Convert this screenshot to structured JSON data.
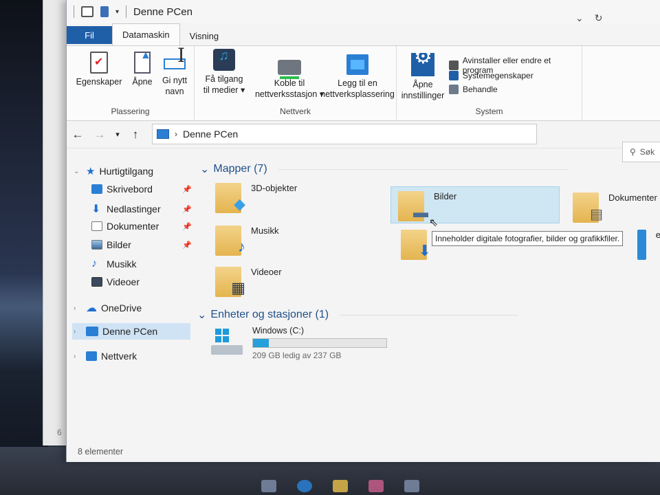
{
  "window": {
    "title": "Denne PCen",
    "status": "8 elementer"
  },
  "back_window": {
    "mini_text": "6"
  },
  "tabs": [
    {
      "label": "Fil"
    },
    {
      "label": "Datamaskin"
    },
    {
      "label": "Visning"
    }
  ],
  "ribbon": {
    "plassering": {
      "label": "Plassering",
      "buttons": [
        {
          "label": "Egenskaper",
          "icon": "properties-icon"
        },
        {
          "label": "Åpne",
          "icon": "open-icon"
        },
        {
          "label": "Gi nytt",
          "label2": "navn",
          "icon": "rename-icon"
        }
      ]
    },
    "nettverk": {
      "label": "Nettverk",
      "buttons": [
        {
          "label": "Få tilgang",
          "label2": "til medier ▾",
          "icon": "media-icon"
        },
        {
          "label": "Koble til",
          "label2": "nettverksstasjon ▾",
          "icon": "network-drive-icon"
        },
        {
          "label": "Legg til en",
          "label2": "nettverksplassering",
          "icon": "network-location-icon"
        }
      ]
    },
    "system": {
      "label": "System",
      "settings_label": "Åpne",
      "settings_label2": "innstillinger",
      "items": [
        {
          "label": "Avinstaller eller endre et program"
        },
        {
          "label": "Systemegenskaper"
        },
        {
          "label": "Behandle"
        }
      ]
    }
  },
  "address": {
    "path": "Denne PCen",
    "search_placeholder": "Søk"
  },
  "sidebar": {
    "quick_access": "Hurtigtilgang",
    "items": [
      {
        "label": "Skrivebord"
      },
      {
        "label": "Nedlastinger"
      },
      {
        "label": "Dokumenter"
      },
      {
        "label": "Bilder"
      },
      {
        "label": "Musikk"
      },
      {
        "label": "Videoer"
      }
    ],
    "onedrive": "OneDrive",
    "this_pc": "Denne PCen",
    "network": "Nettverk"
  },
  "content": {
    "folders_header": "Mapper (7)",
    "folders": [
      {
        "label": "3D-objekter"
      },
      {
        "label": "Bilder"
      },
      {
        "label": "Dokumenter"
      },
      {
        "label": "Musikk"
      },
      {
        "label": "ebord"
      },
      {
        "label": "Videoer"
      }
    ],
    "tooltip": "Inneholder digitale fotografier, bilder og grafikkfiler.",
    "devices_header": "Enheter og stasjoner (1)",
    "drive": {
      "name": "Windows (C:)",
      "free": "209 GB ledig av 237 GB",
      "used_fraction": 0.118
    }
  },
  "colors": {
    "accent": "#1f5fa8",
    "selection": "#cfe6f3",
    "drive_bar": "#26a0da"
  }
}
